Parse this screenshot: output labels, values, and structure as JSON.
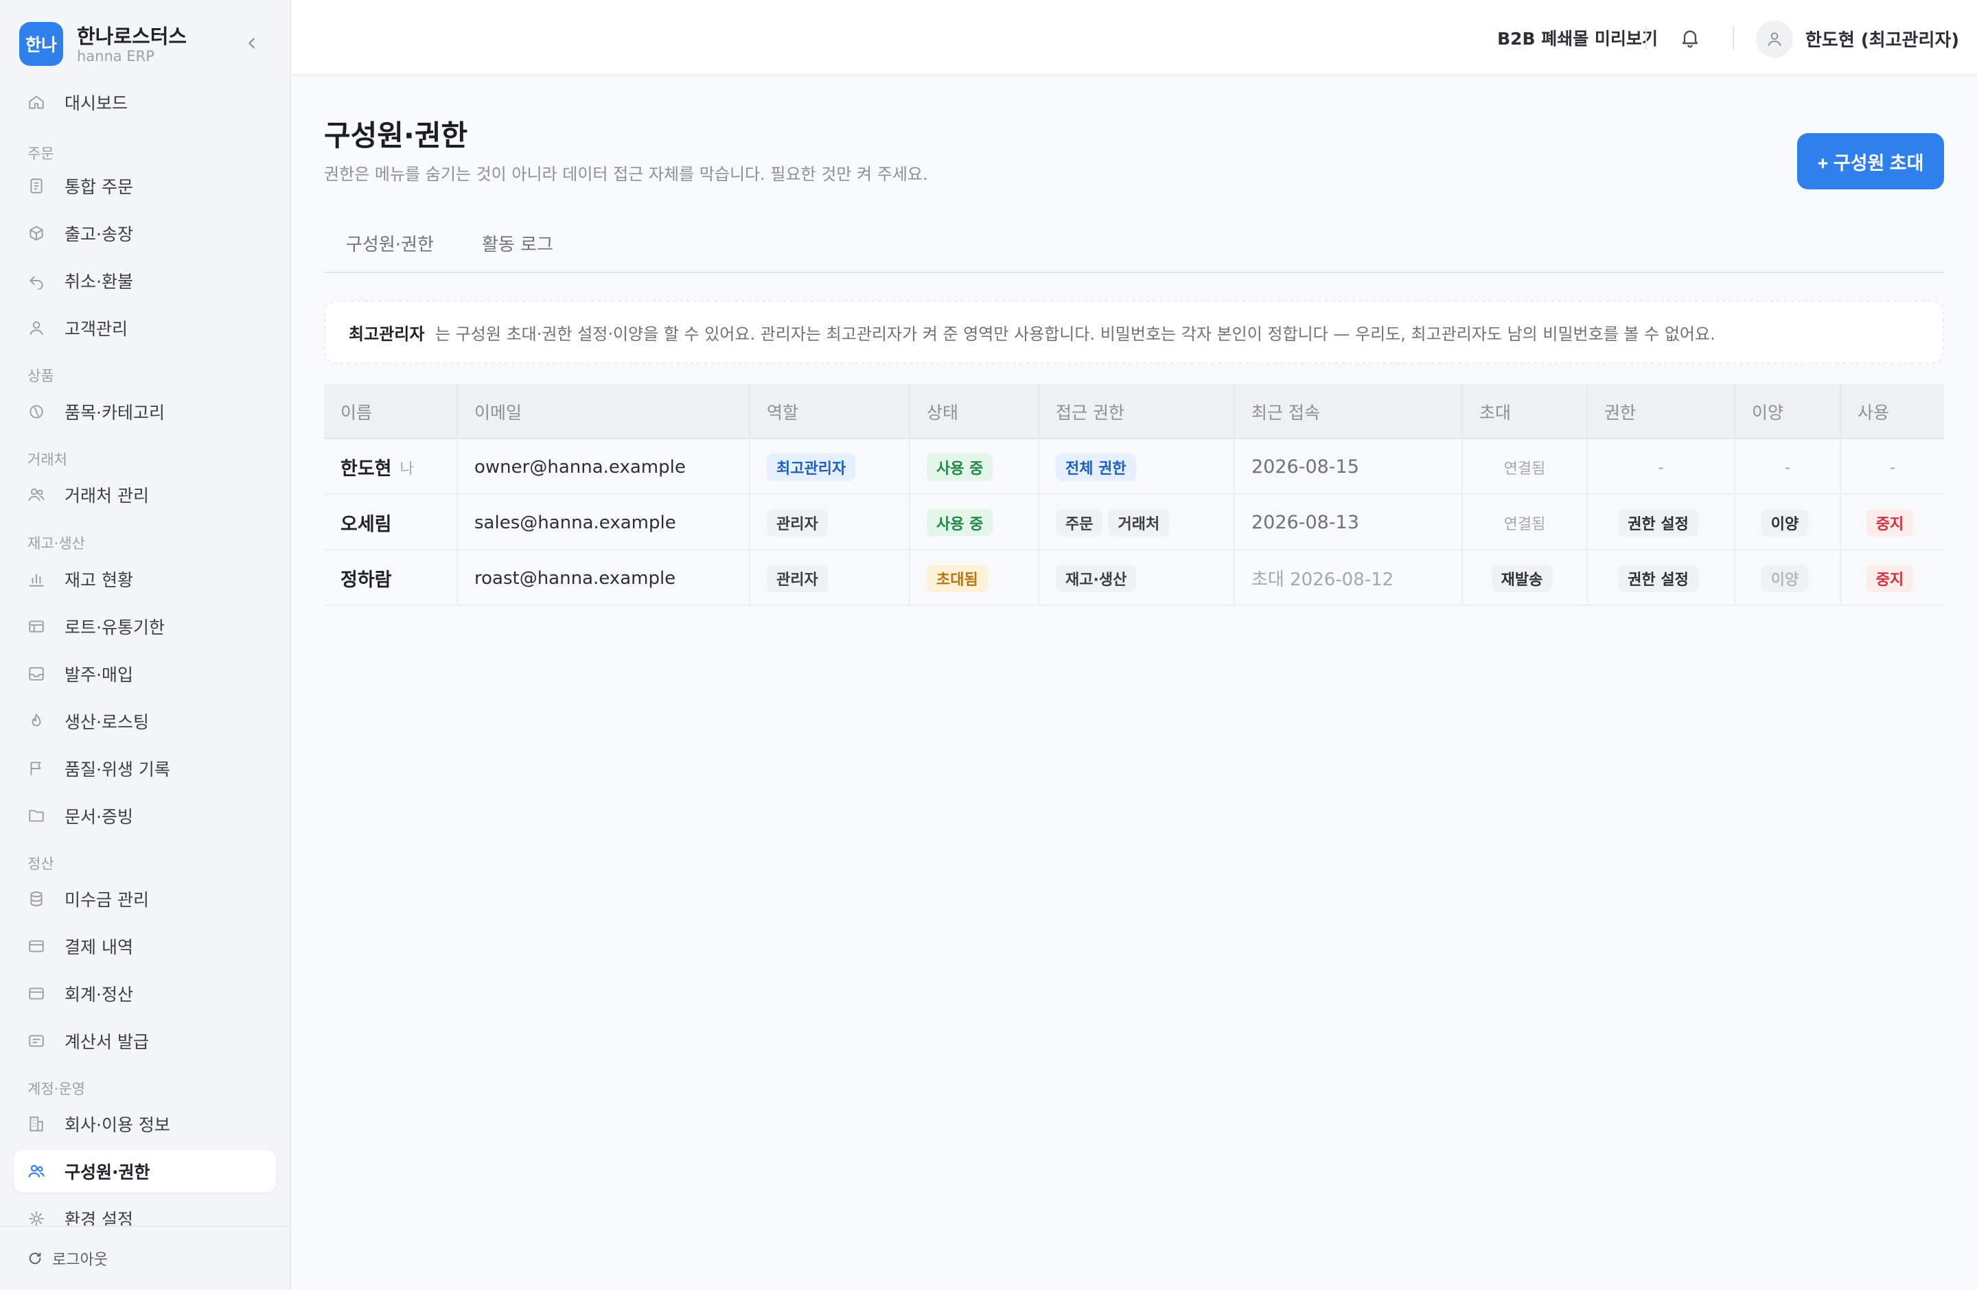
{
  "brand": {
    "logo_text": "한나",
    "name": "한나로스터스",
    "subtitle": "hanna ERP"
  },
  "sidebar": {
    "groups": {
      "order": "주문",
      "product": "상품",
      "partner": "거래처",
      "inventory": "재고·생산",
      "settlement": "정산",
      "account": "계정·운영"
    },
    "items": [
      {
        "label": "대시보드",
        "icon": "home-icon"
      },
      {
        "label": "통합 주문",
        "icon": "document-icon"
      },
      {
        "label": "출고·송장",
        "icon": "box-icon"
      },
      {
        "label": "취소·환불",
        "icon": "undo-icon"
      },
      {
        "label": "고객관리",
        "icon": "user-icon"
      },
      {
        "label": "품목·카테고리",
        "icon": "tag-icon"
      },
      {
        "label": "거래처 관리",
        "icon": "users-icon"
      },
      {
        "label": "재고 현황",
        "icon": "bar-chart-icon"
      },
      {
        "label": "로트·유통기한",
        "icon": "table-icon"
      },
      {
        "label": "발주·매입",
        "icon": "inbox-icon"
      },
      {
        "label": "생산·로스팅",
        "icon": "flame-icon"
      },
      {
        "label": "품질·위생 기록",
        "icon": "flag-icon"
      },
      {
        "label": "문서·증빙",
        "icon": "folder-icon"
      },
      {
        "label": "미수금 관리",
        "icon": "database-icon"
      },
      {
        "label": "결제 내역",
        "icon": "card-icon"
      },
      {
        "label": "회계·정산",
        "icon": "card-icon"
      },
      {
        "label": "계산서 발급",
        "icon": "receipt-icon"
      },
      {
        "label": "회사·이용 정보",
        "icon": "building-icon"
      },
      {
        "label": "구성원·권한",
        "icon": "users-icon"
      },
      {
        "label": "환경 설정",
        "icon": "gear-icon"
      }
    ],
    "active_item": "구성원·권한",
    "logout": "로그아웃"
  },
  "topbar": {
    "preview": "B2B 폐쇄몰 미리보기",
    "user": "한도현 (최고관리자)"
  },
  "page": {
    "title": "구성원·권한",
    "description": "권한은 메뉴를 숨기는 것이 아니라 데이터 접근 자체를 막습니다. 필요한 것만 켜 주세요.",
    "invite_button": "+ 구성원 초대",
    "tabs": [
      "구성원·권한",
      "활동 로그"
    ],
    "notice": {
      "strong": "최고관리자",
      "text": "는 구성원 초대·권한 설정·이양을 할 수 있어요. 관리자는 최고관리자가 켜 준 영역만 사용합니다. 비밀번호는 각자 본인이 정합니다 — 우리도, 최고관리자도 남의 비밀번호를 볼 수 없어요."
    }
  },
  "table": {
    "headers": [
      "이름",
      "이메일",
      "역할",
      "상태",
      "접근 권한",
      "최근 접속",
      "초대",
      "권한",
      "이양",
      "사용"
    ],
    "rows": [
      {
        "name": "한도현",
        "me": "나",
        "email": "owner@hanna.example",
        "role": "최고관리자",
        "status": "사용 중",
        "access": [
          "전체 권한"
        ],
        "last_login": "2026-08-15",
        "invite": "연결됨",
        "permission": "-",
        "transfer": "-",
        "use": "-"
      },
      {
        "name": "오세림",
        "me": "",
        "email": "sales@hanna.example",
        "role": "관리자",
        "status": "사용 중",
        "access": [
          "주문",
          "거래처"
        ],
        "last_login": "2026-08-13",
        "invite": "연결됨",
        "permission": "권한 설정",
        "transfer": "이양",
        "use": "중지"
      },
      {
        "name": "정하람",
        "me": "",
        "email": "roast@hanna.example",
        "role": "관리자",
        "status": "초대됨",
        "access": [
          "재고·생산"
        ],
        "last_login": "초대 2026-08-12",
        "invite": "재발송",
        "permission": "권한 설정",
        "transfer": "이양",
        "use": "중지"
      }
    ]
  },
  "colors": {
    "accent": "#2f80ed",
    "success": "#1e8a43",
    "warning": "#b8740a",
    "danger": "#d6303a"
  }
}
